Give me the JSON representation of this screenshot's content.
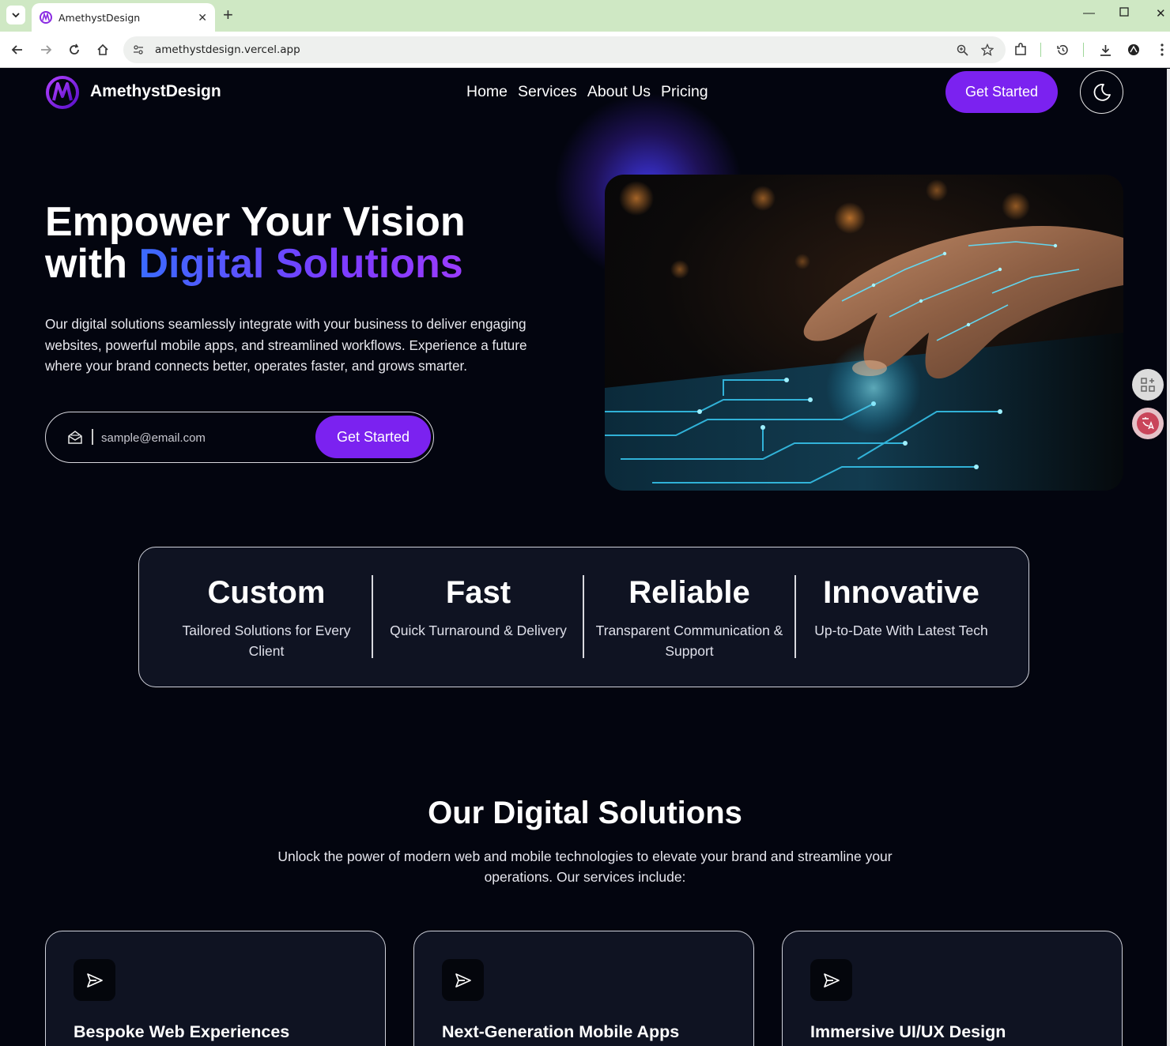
{
  "browser": {
    "tab_title": "AmethystDesign",
    "tab_close": "✕",
    "new_tab": "+",
    "url": "amethystdesign.vercel.app"
  },
  "nav": {
    "brand": "AmethystDesign",
    "links": [
      "Home",
      "Services",
      "About Us",
      "Pricing"
    ],
    "cta": "Get Started"
  },
  "hero": {
    "title_line1": "Empower Your Vision",
    "title_with": "with",
    "title_highlight": "Digital Solutions",
    "description": "Our digital solutions seamlessly integrate with your business to deliver engaging websites, powerful mobile apps, and streamlined workflows. Experience a future where your brand connects better, operates faster, and grows smarter.",
    "email_placeholder": "sample@email.com",
    "cta": "Get Started"
  },
  "features": [
    {
      "title": "Custom",
      "subtitle": "Tailored Solutions for Every Client"
    },
    {
      "title": "Fast",
      "subtitle": "Quick Turnaround & Delivery"
    },
    {
      "title": "Reliable",
      "subtitle": "Transparent Communication & Support"
    },
    {
      "title": "Innovative",
      "subtitle": "Up-to-Date With Latest Tech"
    }
  ],
  "solutions": {
    "title": "Our Digital Solutions",
    "description": "Unlock the power of modern web and mobile technologies to elevate your brand and streamline your operations. Our services include:",
    "cards": [
      {
        "title": "Bespoke Web Experiences",
        "icon": "send-icon"
      },
      {
        "title": "Next-Generation Mobile Apps",
        "icon": "send-icon"
      },
      {
        "title": "Immersive UI/UX Design",
        "icon": "send-icon"
      }
    ]
  },
  "colors": {
    "background": "#03050f",
    "accent": "#7b22f0",
    "card_bg": "#0f1322",
    "tabbar": "#cfe8c4"
  }
}
